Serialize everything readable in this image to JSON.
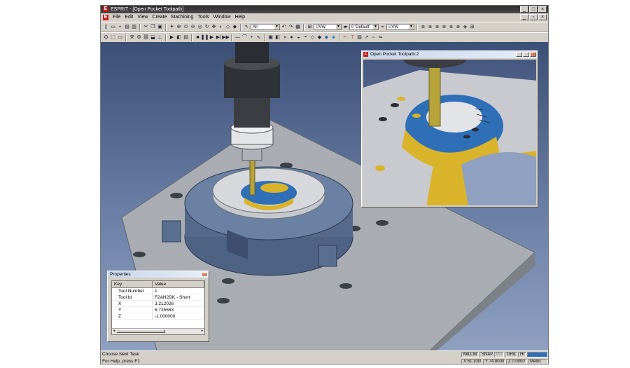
{
  "window": {
    "title": "ESPRIT - [Open Pocket Toolpath]",
    "logo": "E"
  },
  "window_buttons": [
    "_",
    "□",
    "×"
  ],
  "mdi_buttons": [
    "_",
    "▫",
    "×"
  ],
  "menu": [
    "File",
    "Edit",
    "View",
    "Create",
    "Machining",
    "Tools",
    "Window",
    "Help"
  ],
  "toolbar": {
    "select_filter": "All",
    "plane_combo_1": "UVW",
    "layer_combo": "0 'Default'",
    "plane_combo_2": "UVW"
  },
  "subwindow": {
    "title": "Open Pocket Toolpath:2",
    "logo": "E"
  },
  "properties": {
    "title": "Properties",
    "close": "×",
    "columns": [
      "Key",
      "Value"
    ],
    "rows": [
      {
        "key": "Tool Number",
        "value": "1"
      },
      {
        "key": "Tool Id",
        "value": "F2AH2DK - Short"
      },
      {
        "key": "X",
        "value": "3.212026"
      },
      {
        "key": "Y",
        "value": "6.735563"
      },
      {
        "key": "Z",
        "value": "-1.000000"
      }
    ]
  },
  "status": {
    "line1": "Choose Next Task",
    "line2": "For Help, press F1",
    "mode_indicators": [
      "MILLIN",
      "SNAP",
      "INT",
      "GRID",
      "HI"
    ],
    "x": "X 61.1000",
    "y": "Y 74.8000",
    "z": "Z 0.0000",
    "units": "Metric"
  },
  "colors": {
    "viewport_top": "#3c4f76",
    "viewport_bottom": "#8fa0c0",
    "part_gray": "#a9adb3",
    "fixture_blue": "#556a8a",
    "toolpath_yellow": "#d9b42a",
    "pocket_blue": "#2f6fb8",
    "accent_red": "#c61a1a"
  }
}
